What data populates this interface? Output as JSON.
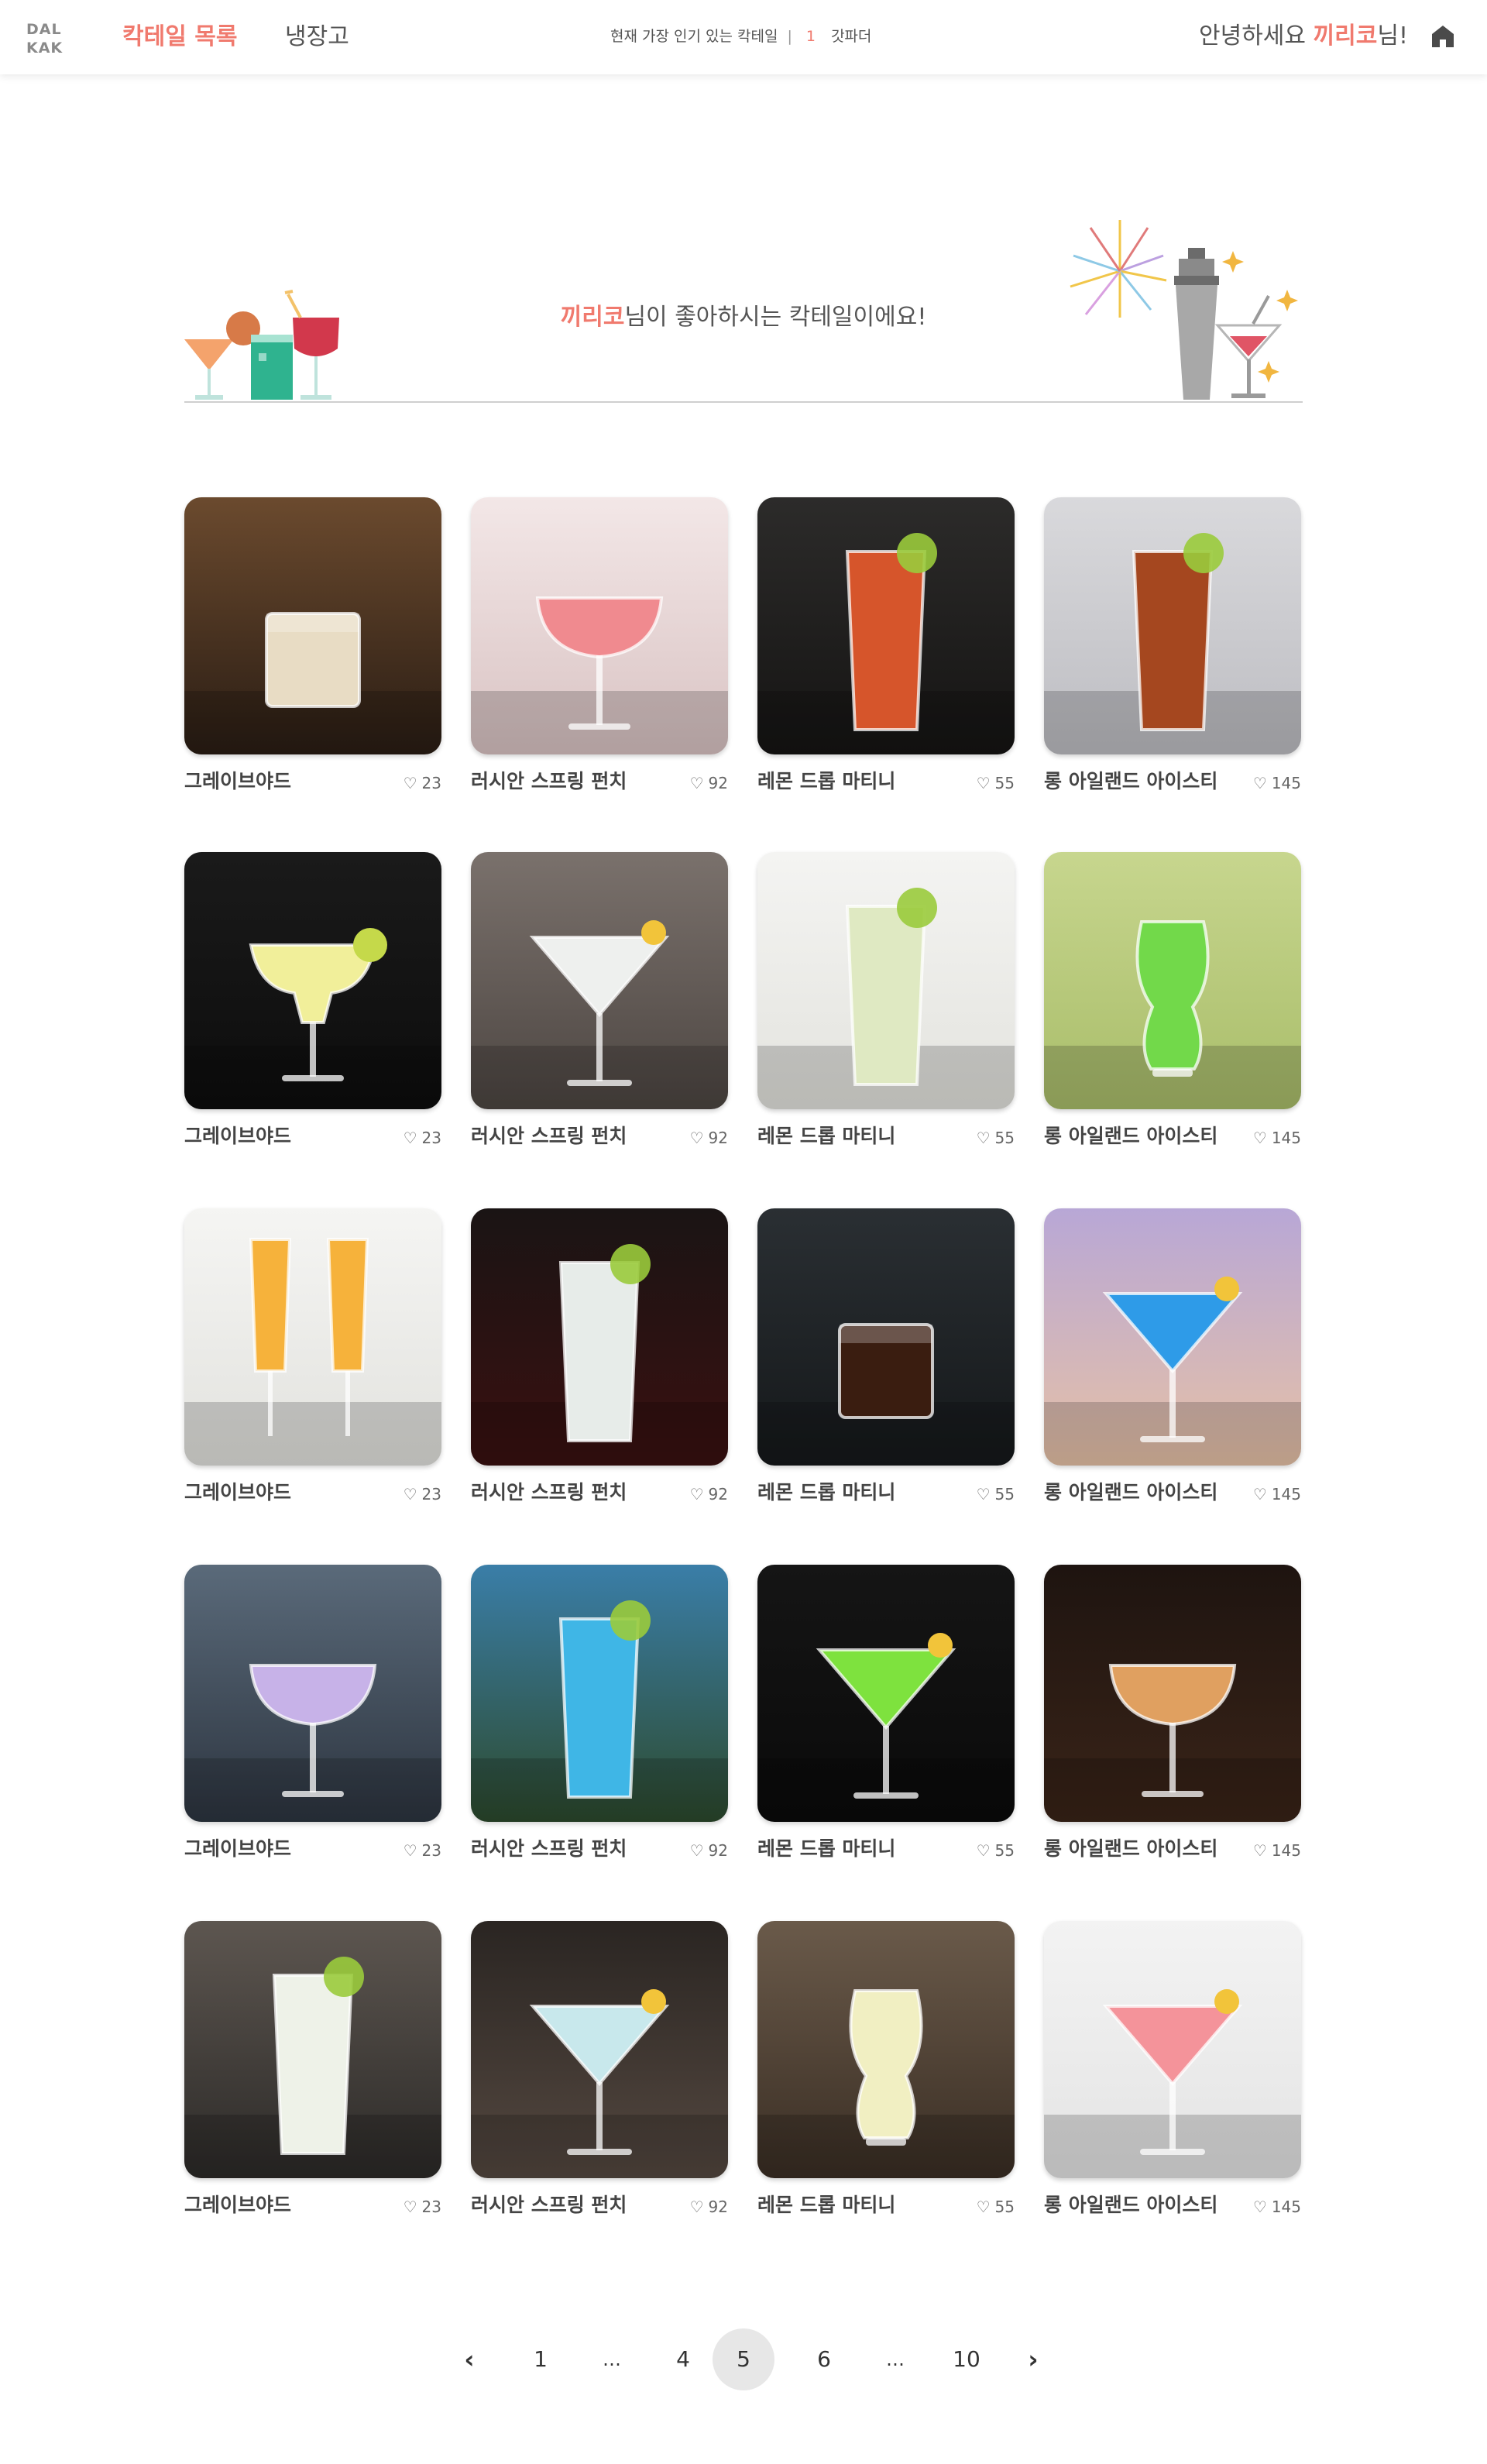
{
  "header": {
    "logo_line1": "DAL",
    "logo_line2": "KAK",
    "nav": [
      {
        "label": "칵테일 목록",
        "active": true
      },
      {
        "label": "냉장고",
        "active": false
      }
    ],
    "popular_label": "현재 가장 인기 있는 칵테일",
    "popular_separator": "|",
    "popular_rank": "1",
    "popular_name": "갓파더",
    "greeting_prefix": "안녕하세요 ",
    "user_name": "끼리코",
    "greeting_suffix": "님!",
    "home_icon": "home-icon"
  },
  "banner": {
    "user_name": "끼리코",
    "text_suffix": "님이 좋아하시는 칵테일이에요!"
  },
  "cocktails": [
    {
      "name": "그레이브야드",
      "likes": "23"
    },
    {
      "name": "러시안 스프링 펀치",
      "likes": "92"
    },
    {
      "name": "레몬 드롭 마티니",
      "likes": "55"
    },
    {
      "name": "롱 아일랜드 아이스티",
      "likes": "145"
    },
    {
      "name": "그레이브야드",
      "likes": "23"
    },
    {
      "name": "러시안 스프링 펀치",
      "likes": "92"
    },
    {
      "name": "레몬 드롭 마티니",
      "likes": "55"
    },
    {
      "name": "롱 아일랜드 아이스티",
      "likes": "145"
    },
    {
      "name": "그레이브야드",
      "likes": "23"
    },
    {
      "name": "러시안 스프링 펀치",
      "likes": "92"
    },
    {
      "name": "레몬 드롭 마티니",
      "likes": "55"
    },
    {
      "name": "롱 아일랜드 아이스티",
      "likes": "145"
    },
    {
      "name": "그레이브야드",
      "likes": "23"
    },
    {
      "name": "러시안 스프링 펀치",
      "likes": "92"
    },
    {
      "name": "레몬 드롭 마티니",
      "likes": "55"
    },
    {
      "name": "롱 아일랜드 아이스티",
      "likes": "145"
    },
    {
      "name": "그레이브야드",
      "likes": "23"
    },
    {
      "name": "러시안 스프링 펀치",
      "likes": "92"
    },
    {
      "name": "레몬 드롭 마티니",
      "likes": "55"
    },
    {
      "name": "롱 아일랜드 아이스티",
      "likes": "145"
    }
  ],
  "pagination": {
    "prev": "‹",
    "pages": [
      "1",
      "…",
      "4",
      "5",
      "6",
      "…",
      "10"
    ],
    "current": "5",
    "next": "›"
  },
  "colors": {
    "accent": "#f07a6e",
    "text": "#333333",
    "muted": "#666666"
  }
}
